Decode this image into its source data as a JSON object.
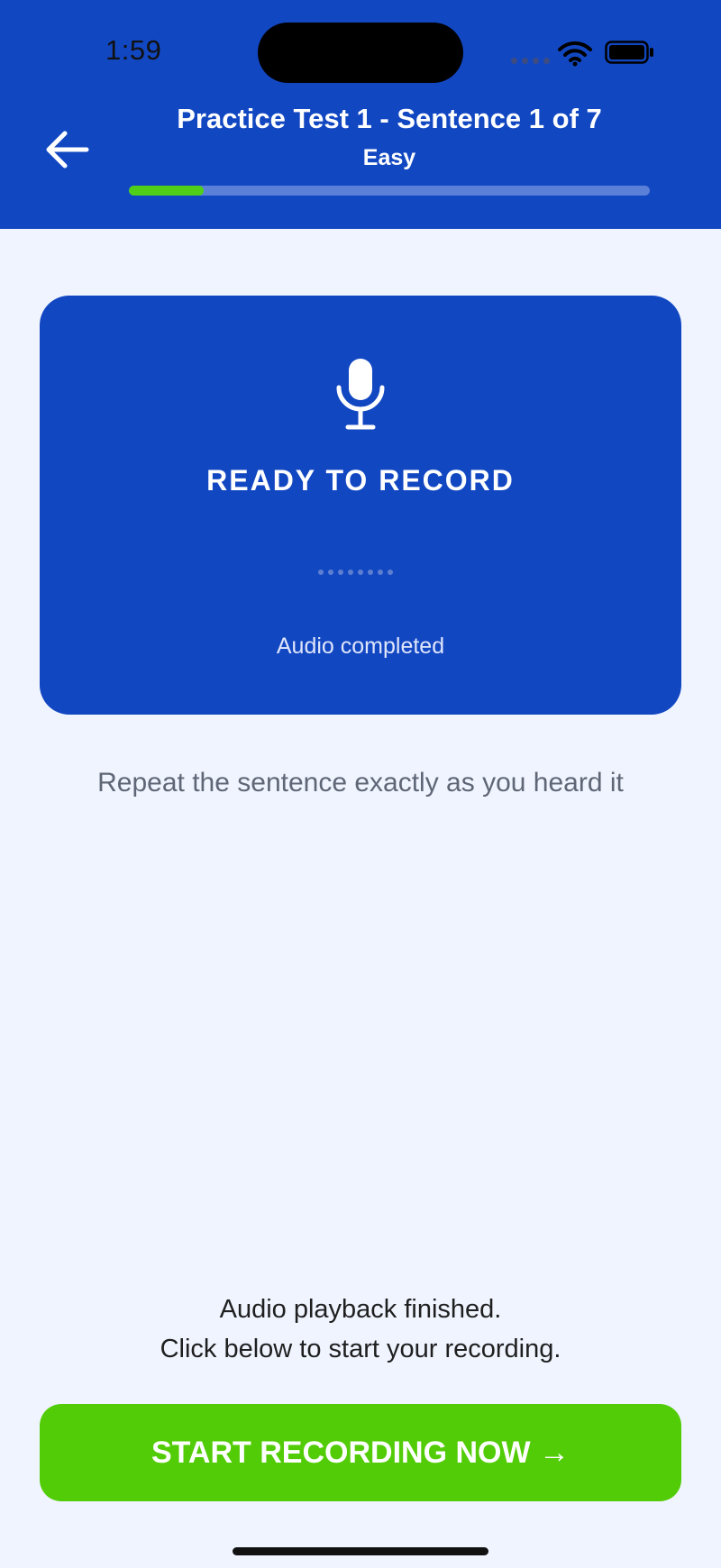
{
  "status_bar": {
    "time": "1:59"
  },
  "header": {
    "title": "Practice Test 1 - Sentence 1 of 7",
    "subtitle": "Easy",
    "progress_fraction": 0.143,
    "progress_color": "#4fcf18"
  },
  "record_card": {
    "title": "READY TO RECORD",
    "status": "Audio completed",
    "icon": "microphone-icon"
  },
  "instruction": "Repeat the sentence exactly as you heard it",
  "finished_message": {
    "line1": "Audio playback finished.",
    "line2": "Click below to start your recording."
  },
  "start_button": {
    "label": "START RECORDING NOW →",
    "color": "#53cc08"
  },
  "colors": {
    "primary": "#1247c2",
    "background": "#eff4ff"
  }
}
